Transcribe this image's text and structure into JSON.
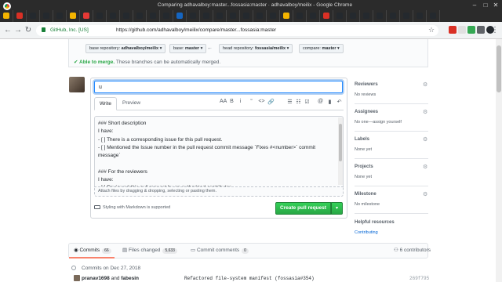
{
  "browser": {
    "window_title": "Comparing adhavalboy:master...fossasia:master · adhavalboy/meilix - Google Chrome",
    "url_org": "GitHub, Inc. [US]",
    "url": "https://github.com/adhavalboy/meilix/compare/master...fossasia:master",
    "tab_favicon_colors": [
      "#f4b400",
      "#d93025",
      "#24292e",
      "#24292e",
      "#24292e",
      "#f4b400",
      "#e53935",
      "#24292e",
      "#24292e",
      "#24292e",
      "#24292e",
      "#24292e",
      "#24292e",
      "#1565c0",
      "#24292e",
      "#24292e",
      "#24292e",
      "#24292e",
      "#24292e",
      "#24292e",
      "#24292e",
      "#f4b400",
      "#24292e",
      "#24292e",
      "#d93025",
      "#24292e",
      "#24292e",
      "#24292e",
      "#24292e",
      "#24292e",
      "#24292e",
      "#24292e",
      "#24292e"
    ],
    "extension_colors": [
      "#d93025",
      "#e0e0e0",
      "#34a853",
      "#5f6368",
      "#24292e"
    ]
  },
  "compare": {
    "base_repo_label": "base repository:",
    "base_repo": "adhavalboy/meilix",
    "base_label": "base:",
    "base": "master",
    "head_repo_label": "head repository:",
    "head_repo": "fossasia/meilix",
    "compare_label": "compare:",
    "compare": "master",
    "merge_ok": "✔ Able to merge.",
    "merge_text": "These branches can be automatically merged."
  },
  "form": {
    "title_value": "u",
    "tab_write": "Write",
    "tab_preview": "Preview",
    "toolbar": [
      "AA",
      "B",
      "i",
      "“",
      "<>",
      "🔗",
      "☰",
      "☷",
      "☑",
      "@",
      "▮",
      "↶"
    ],
    "body": "### Short description\nI have:\n- [ ] There is a corresponding issue for this pull request.\n- [ ] Mentioned the Issue number in the pull request commit message `Fixes #<number>` commit message`\n\n### For the reviewers\nI have:\n- [ ] Reviewed this pull request by an authorized contributor",
    "attach_hint": "Attach files by dragging & dropping, selecting or pasting them.",
    "markdown_note": "Styling with Markdown is supported",
    "create_button": "Create pull request",
    "caret": "▾"
  },
  "sidebar": {
    "reviewers_title": "Reviewers",
    "reviewers_value": "No reviews",
    "assignees_title": "Assignees",
    "assignees_value": "No one—assign yourself",
    "labels_title": "Labels",
    "labels_value": "None yet",
    "projects_title": "Projects",
    "projects_value": "None yet",
    "milestone_title": "Milestone",
    "milestone_value": "No milestone",
    "resources_title": "Helpful resources",
    "resources_link": "Contributing"
  },
  "bottom": {
    "commits_label": "Commits",
    "commits_count": "66",
    "files_label": "Files changed",
    "files_count": "5,633",
    "comments_label": "Commit comments",
    "comments_count": "0",
    "contributors": "6 contributors",
    "date": "Commits on Dec 27, 2018",
    "commit_author": "pranav1698",
    "commit_and": "and",
    "commit_coauthor": "fabesin",
    "commit_message": "Refactored file-system manifest (fossasia#354)",
    "commit_sha": "269f795"
  }
}
